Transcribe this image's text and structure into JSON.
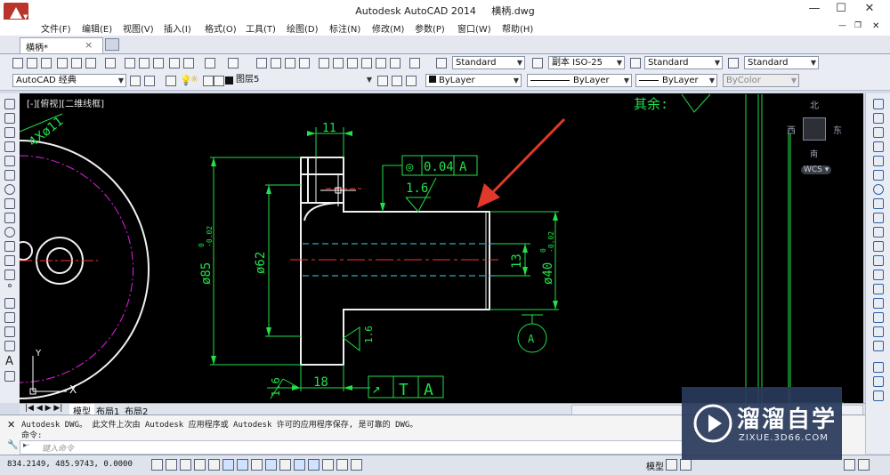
{
  "window": {
    "title": "Autodesk AutoCAD 2014",
    "filename": "横柄.dwg",
    "controls": [
      "—",
      "☐",
      "✕"
    ]
  },
  "menu": [
    "文件(F)",
    "编辑(E)",
    "视图(V)",
    "插入(I)",
    "格式(O)",
    "工具(T)",
    "绘图(D)",
    "标注(N)",
    "修改(M)",
    "参数(P)",
    "窗口(W)",
    "帮助(H)"
  ],
  "doc_tab": {
    "label": "横柄*",
    "close": "×"
  },
  "toolbar1": {
    "text_style": "Standard",
    "dim_style": "副本 ISO-25",
    "table_style": "Standard",
    "mleader_style": "Standard"
  },
  "toolbar2": {
    "workspace": "AutoCAD 经典",
    "layer": "图层5",
    "color": "ByLayer",
    "linetype": "ByLayer",
    "lineweight": "ByLayer",
    "plotstyle": "ByColor"
  },
  "viewport": {
    "label": "[-][俯视][二维线框]",
    "viewcube": {
      "north": "北",
      "west": "西",
      "east": "东",
      "south": "南",
      "wcs": "WCS ▾"
    }
  },
  "drawing": {
    "dim_11": "11",
    "dim_phi85": "ø85",
    "tol_85_upper": "0",
    "tol_85_lower": "-0.02",
    "dim_phi62": "ø62",
    "dim_phi40": "ø40",
    "tol_40_upper": "0",
    "tol_40_lower": "-0.02",
    "dim_13": "13",
    "dim_18": "18",
    "rough_top": "1.6",
    "rough_mid": "1.6",
    "rough_left": "1.6",
    "rough_rest": "其余:",
    "gdt_symbol": "◎",
    "gdt_tol": "0.04",
    "gdt_datum": "A",
    "gdt2_symbol": "↗",
    "gdt2_tol": "T",
    "gdt2_datum": "A",
    "datum_label": "A",
    "holes_label": "4Xø11",
    "ucs_y": "Y",
    "ucs_x": "X"
  },
  "layout_tabs": [
    "模型",
    "布局1",
    "布局2"
  ],
  "command": {
    "history": "Autodesk DWG。 此文件上次由 Autodesk 应用程序或 Autodesk 许可的应用程序保存, 是可靠的 DWG。",
    "prompt_label": "命令:",
    "input_placeholder": "键入命令"
  },
  "status": {
    "coords": "834.2149, 485.9743, 0.0000",
    "model": "模型"
  },
  "watermark": {
    "brand": "溜溜自学",
    "url": "ZIXUE.3D66.COM"
  },
  "colors": {
    "dim_green": "#22e04a",
    "arrow_red": "#e0392b",
    "center_red": "#ff3030",
    "hidden_cyan": "#37d6e8",
    "geometry": "#f0f0f0",
    "magenta": "#e020e0"
  }
}
